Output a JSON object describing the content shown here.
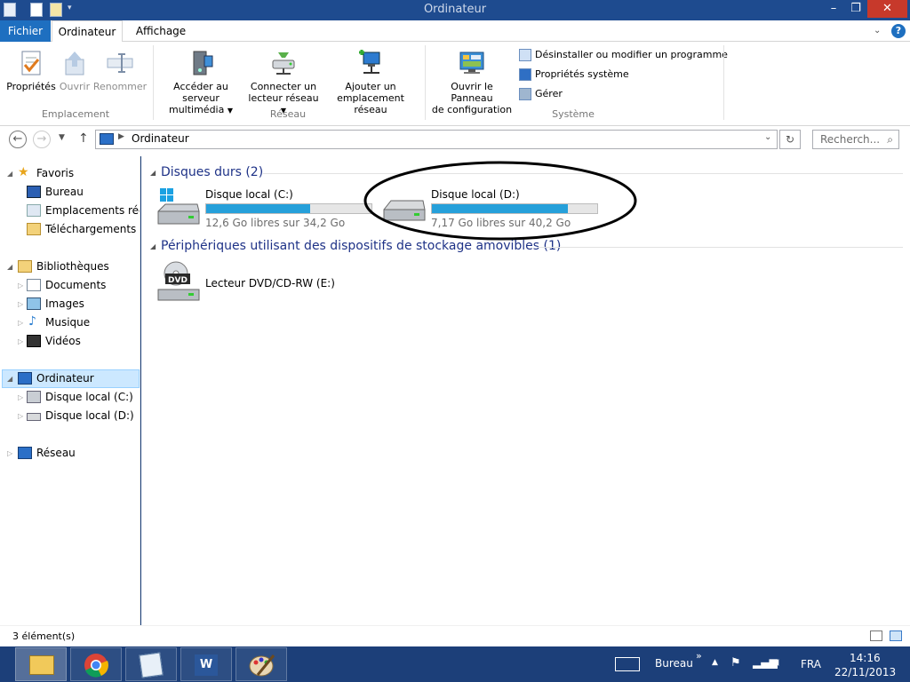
{
  "window": {
    "title": "Ordinateur",
    "minimize_icon": "minimize-icon",
    "maximize_icon": "restore-icon",
    "close_icon": "close-icon"
  },
  "ribbon_tabs": {
    "fichier": "Fichier",
    "ordinateur": "Ordinateur",
    "affichage": "Affichage",
    "help": "?"
  },
  "ribbon": {
    "groups": {
      "emplacement": "Emplacement",
      "reseau": "Réseau",
      "systeme": "Système"
    },
    "buttons": {
      "proprietes": "Propriétés",
      "ouvrir": "Ouvrir",
      "renommer": "Renommer",
      "acceder_line1": "Accéder au serveur",
      "acceder_line2": "multimédia",
      "connecter_line1": "Connecter un",
      "connecter_line2": "lecteur réseau",
      "ajouter_line1": "Ajouter un",
      "ajouter_line2": "emplacement réseau",
      "panneau_line1": "Ouvrir le Panneau",
      "panneau_line2": "de configuration",
      "desinstaller": "Désinstaller ou modifier un programme",
      "proprietes_systeme": "Propriétés système",
      "gerer": "Gérer"
    }
  },
  "address": {
    "path": "Ordinateur",
    "search_placeholder": "Recherch..."
  },
  "nav": {
    "favoris": "Favoris",
    "bureau": "Bureau",
    "emplacements": "Emplacements récer",
    "telechargements": "Téléchargements",
    "bibliotheques": "Bibliothèques",
    "documents": "Documents",
    "images": "Images",
    "musique": "Musique",
    "videos": "Vidéos",
    "ordinateur": "Ordinateur",
    "disque_c": "Disque local (C:)",
    "disque_d": "Disque local (D:)",
    "reseau": "Réseau"
  },
  "content": {
    "group_disques": "Disques durs (2)",
    "group_amovibles": "Périphériques utilisant des dispositifs de stockage amovibles (1)",
    "drives": [
      {
        "name": "Disque local (C:)",
        "free": "12,6 Go libres sur 34,2 Go",
        "used_fraction": 0.63
      },
      {
        "name": "Disque local (D:)",
        "free": "7,17 Go libres sur 40,2 Go",
        "used_fraction": 0.82
      }
    ],
    "dvd": {
      "name": "Lecteur DVD/CD-RW (E:)",
      "label": "DVD"
    }
  },
  "status": {
    "count": "3 élément(s)"
  },
  "taskbar": {
    "bureau": "Bureau",
    "lang": "FRA",
    "time": "14:16",
    "date": "22/11/2013",
    "word_label": "W"
  },
  "colors": {
    "accent": "#1e6fc0",
    "drive_bar": "#26a0da",
    "taskbar": "#1c3f79"
  }
}
